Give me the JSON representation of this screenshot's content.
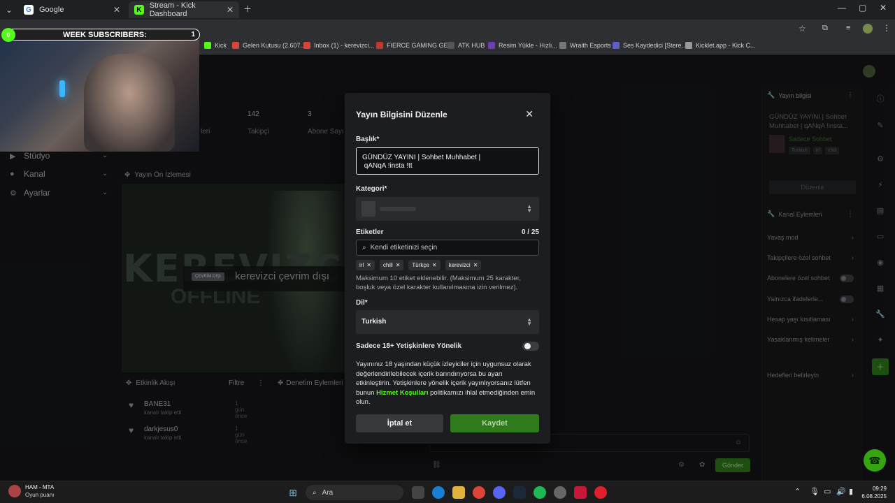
{
  "browser": {
    "tabs": [
      {
        "title": "Google"
      },
      {
        "title": "Stream - Kick Dashboard"
      }
    ],
    "bookmarks": [
      {
        "label": "Kick",
        "color": "#53fc18"
      },
      {
        "label": "Gelen Kutusu (2.607...",
        "color": "#d44638"
      },
      {
        "label": "Inbox (1) - kerevizci...",
        "color": "#d44638"
      },
      {
        "label": "FIERCE GAMING GE...",
        "color": "#c0392b"
      },
      {
        "label": "ATK HUB",
        "color": "#888888"
      },
      {
        "label": "Resim Yükle - Hızlı...",
        "color": "#6c3fb5"
      },
      {
        "label": "Wraith Esports",
        "color": "#cccccc"
      },
      {
        "label": "Ses Kaydedici [Stere...",
        "color": "#5b5fc7"
      },
      {
        "label": "Kicklet.app - Kick C...",
        "color": "#999999"
      }
    ]
  },
  "overlay": {
    "subs_badge": "0",
    "subs_label": "WEEK SUBSCRIBERS:",
    "subs_count": "1"
  },
  "dashboard": {
    "nav": [
      {
        "label": "Stüdyo",
        "icon": "video-icon"
      },
      {
        "label": "Kanal",
        "icon": "person-icon"
      },
      {
        "label": "Ayarlar",
        "icon": "gear-icon"
      }
    ],
    "stats": [
      {
        "value": "142",
        "label": "Takipçi"
      },
      {
        "value": "3",
        "label": "Abone Sayı"
      }
    ],
    "stat_partial_label": "leri",
    "preview_title": "Yayın Ön İzlemesi",
    "preview_big": "KEREVIZCİ",
    "preview_offline": "OFFLINE",
    "preview_badge": "ÇEVRİM DIŞI",
    "preview_status": "kerevizci çevrim dışı",
    "activity_title": "Etkinlik Akışı",
    "activity_filter": "Filtre",
    "moderation_title": "Denetim Eylemleri",
    "activity": [
      {
        "name": "BANE31",
        "sub": "kanalı takip etti",
        "time": "1 gün önce"
      },
      {
        "name": "darkjesus0",
        "sub": "kanalı takip etti",
        "time": "1 gün önce"
      }
    ],
    "chat_send": "Gönder"
  },
  "right_panel": {
    "info_title": "Yayın bilgisi",
    "stream_title": "GÜNDÜZ YAYINI | Sohbet Muhhabet | qANqA !insta...",
    "category": "Sadece Sohbet",
    "tags": [
      "Turkish",
      "irl",
      "chill"
    ],
    "edit_label": "Düzenle",
    "actions_title": "Kanal Eylemleri",
    "actions": [
      {
        "label": "Yavaş mod",
        "kind": "chevron"
      },
      {
        "label": "Takipçilere özel sohbet",
        "kind": "chevron"
      },
      {
        "label": "Abonelere özel sohbet",
        "kind": "toggle"
      },
      {
        "label": "Yalnızca ifadelerle...",
        "kind": "toggle"
      },
      {
        "label": "Hesap yaşı kısıtlaması",
        "kind": "chevron"
      },
      {
        "label": "Yasaklanmış kelimeler",
        "kind": "chevron"
      },
      {
        "label": "Hedefleri belirleyin",
        "kind": "chevron"
      }
    ]
  },
  "modal": {
    "title": "Yayın Bilgisini Düzenle",
    "title_label": "Başlık*",
    "title_value": "GÜNDÜZ YAYINI | Sohbet Muhhabet |\n qANqA !insta !tt",
    "category_label": "Kategori*",
    "tags_label": "Etiketler",
    "tags_counter": "0 / 25",
    "tags_placeholder": "Kendi etiketinizi seçin",
    "tags": [
      "irl",
      "chill",
      "Türkçe",
      "kerevizci"
    ],
    "tags_hint": "Maksimum 10 etiket eklenebilir. (Maksimum 25 karakter, boşluk veya özel karakter kullanılmasına izin verilmez).",
    "language_label": "Dil*",
    "language_value": "Turkish",
    "adult_label": "Sadece 18+ Yetişkinlere Yönelik",
    "warning_pre": "Yayınınız 18 yaşından küçük izleyiciler için uygunsuz olarak değerlendirilebilecek içerik barındırıyorsa bu ayarı etkinleştirin. Yetişkinlere yönelik içerik yayınlıyorsanız lütfen bunun ",
    "warning_link": "Hizmet Koşulları",
    "warning_post": " politikamızı ihlal etmediğinden emin olun.",
    "cancel": "İptal et",
    "save": "Kaydet"
  },
  "taskbar": {
    "game_title": "HAM - MTA",
    "game_sub": "Oyun puanı",
    "search": "Ara",
    "time": "09:29",
    "date": "6.08.2025"
  }
}
